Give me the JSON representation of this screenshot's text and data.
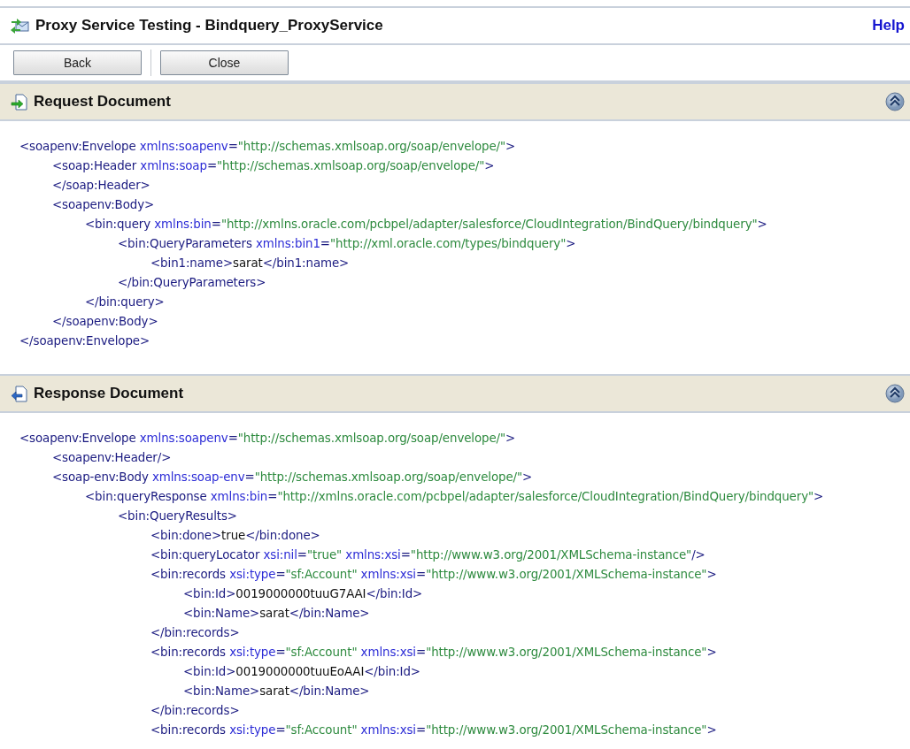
{
  "header": {
    "title": "Proxy Service Testing - Bindquery_ProxyService",
    "help": "Help"
  },
  "buttons": [
    {
      "label": "Back"
    },
    {
      "label": "Close"
    }
  ],
  "sections": [
    {
      "title": "Request Document",
      "kind": "request",
      "expanded": true,
      "lines": [
        {
          "tokens": [
            {
              "kind": "tag",
              "text": "<soapenv:Envelope "
            },
            {
              "kind": "attr",
              "text": "xmlns:soapenv"
            },
            {
              "kind": "tag",
              "text": "="
            },
            {
              "kind": "value",
              "text": "\"http://schemas.xmlsoap.org/soap/envelope/\""
            },
            {
              "kind": "tag",
              "text": ">"
            }
          ],
          "children": [
            {
              "tokens": [
                {
                  "kind": "tag",
                  "text": "<soap:Header "
                },
                {
                  "kind": "attr",
                  "text": "xmlns:soap"
                },
                {
                  "kind": "tag",
                  "text": "="
                },
                {
                  "kind": "value",
                  "text": "\"http://schemas.xmlsoap.org/soap/envelope/\""
                },
                {
                  "kind": "tag",
                  "text": ">"
                }
              ]
            },
            {
              "tokens": [
                {
                  "kind": "tag",
                  "text": "</soap:Header>"
                }
              ]
            },
            {
              "tokens": [
                {
                  "kind": "tag",
                  "text": "<soapenv:Body>"
                }
              ],
              "children": [
                {
                  "tokens": [
                    {
                      "kind": "tag",
                      "text": "<bin:query "
                    },
                    {
                      "kind": "attr",
                      "text": "xmlns:bin"
                    },
                    {
                      "kind": "tag",
                      "text": "="
                    },
                    {
                      "kind": "value",
                      "text": "\"http://xmlns.oracle.com/pcbpel/adapter/salesforce/CloudIntegration/BindQuery/bindquery\""
                    },
                    {
                      "kind": "tag",
                      "text": ">"
                    }
                  ],
                  "children": [
                    {
                      "tokens": [
                        {
                          "kind": "tag",
                          "text": "<bin:QueryParameters "
                        },
                        {
                          "kind": "attr",
                          "text": "xmlns:bin1"
                        },
                        {
                          "kind": "tag",
                          "text": "="
                        },
                        {
                          "kind": "value",
                          "text": "\"http://xml.oracle.com/types/bindquery\""
                        },
                        {
                          "kind": "tag",
                          "text": ">"
                        }
                      ],
                      "children": [
                        {
                          "tokens": [
                            {
                              "kind": "tag",
                              "text": "<bin1:name>"
                            },
                            {
                              "kind": "text",
                              "text": "sarat"
                            },
                            {
                              "kind": "tag",
                              "text": "</bin1:name>"
                            }
                          ]
                        }
                      ]
                    },
                    {
                      "tokens": [
                        {
                          "kind": "tag",
                          "text": "</bin:QueryParameters>"
                        }
                      ]
                    }
                  ]
                },
                {
                  "tokens": [
                    {
                      "kind": "tag",
                      "text": "</bin:query>"
                    }
                  ]
                }
              ]
            },
            {
              "tokens": [
                {
                  "kind": "tag",
                  "text": "</soapenv:Body>"
                }
              ]
            }
          ]
        },
        {
          "tokens": [
            {
              "kind": "tag",
              "text": "</soapenv:Envelope>"
            }
          ]
        }
      ]
    },
    {
      "title": "Response Document",
      "kind": "response",
      "expanded": true,
      "lines": [
        {
          "tokens": [
            {
              "kind": "tag",
              "text": "<soapenv:Envelope "
            },
            {
              "kind": "attr",
              "text": "xmlns:soapenv"
            },
            {
              "kind": "tag",
              "text": "="
            },
            {
              "kind": "value",
              "text": "\"http://schemas.xmlsoap.org/soap/envelope/\""
            },
            {
              "kind": "tag",
              "text": ">"
            }
          ],
          "children": [
            {
              "tokens": [
                {
                  "kind": "tag",
                  "text": "<soapenv:Header/>"
                }
              ]
            },
            {
              "tokens": [
                {
                  "kind": "tag",
                  "text": "<soap-env:Body "
                },
                {
                  "kind": "attr",
                  "text": "xmlns:soap-env"
                },
                {
                  "kind": "tag",
                  "text": "="
                },
                {
                  "kind": "value",
                  "text": "\"http://schemas.xmlsoap.org/soap/envelope/\""
                },
                {
                  "kind": "tag",
                  "text": ">"
                }
              ],
              "children": [
                {
                  "tokens": [
                    {
                      "kind": "tag",
                      "text": "<bin:queryResponse "
                    },
                    {
                      "kind": "attr",
                      "text": "xmlns:bin"
                    },
                    {
                      "kind": "tag",
                      "text": "="
                    },
                    {
                      "kind": "value",
                      "text": "\"http://xmlns.oracle.com/pcbpel/adapter/salesforce/CloudIntegration/BindQuery/bindquery\""
                    },
                    {
                      "kind": "tag",
                      "text": ">"
                    }
                  ],
                  "children": [
                    {
                      "tokens": [
                        {
                          "kind": "tag",
                          "text": "<bin:QueryResults>"
                        }
                      ],
                      "children": [
                        {
                          "tokens": [
                            {
                              "kind": "tag",
                              "text": "<bin:done>"
                            },
                            {
                              "kind": "text",
                              "text": "true"
                            },
                            {
                              "kind": "tag",
                              "text": "</bin:done>"
                            }
                          ]
                        },
                        {
                          "tokens": [
                            {
                              "kind": "tag",
                              "text": "<bin:queryLocator "
                            },
                            {
                              "kind": "attr",
                              "text": "xsi:nil"
                            },
                            {
                              "kind": "tag",
                              "text": "="
                            },
                            {
                              "kind": "value",
                              "text": "\"true\" "
                            },
                            {
                              "kind": "attr",
                              "text": "xmlns:xsi"
                            },
                            {
                              "kind": "tag",
                              "text": "="
                            },
                            {
                              "kind": "value",
                              "text": "\"http://www.w3.org/2001/XMLSchema-instance\""
                            },
                            {
                              "kind": "tag",
                              "text": "/>"
                            }
                          ]
                        },
                        {
                          "tokens": [
                            {
                              "kind": "tag",
                              "text": "<bin:records "
                            },
                            {
                              "kind": "attr",
                              "text": "xsi:type"
                            },
                            {
                              "kind": "tag",
                              "text": "="
                            },
                            {
                              "kind": "value",
                              "text": "\"sf:Account\" "
                            },
                            {
                              "kind": "attr",
                              "text": "xmlns:xsi"
                            },
                            {
                              "kind": "tag",
                              "text": "="
                            },
                            {
                              "kind": "value",
                              "text": "\"http://www.w3.org/2001/XMLSchema-instance\""
                            },
                            {
                              "kind": "tag",
                              "text": ">"
                            }
                          ],
                          "children": [
                            {
                              "tokens": [
                                {
                                  "kind": "tag",
                                  "text": "<bin:Id>"
                                },
                                {
                                  "kind": "text",
                                  "text": "0019000000tuuG7AAI"
                                },
                                {
                                  "kind": "tag",
                                  "text": "</bin:Id>"
                                }
                              ]
                            },
                            {
                              "tokens": [
                                {
                                  "kind": "tag",
                                  "text": "<bin:Name>"
                                },
                                {
                                  "kind": "text",
                                  "text": "sarat"
                                },
                                {
                                  "kind": "tag",
                                  "text": "</bin:Name>"
                                }
                              ]
                            }
                          ]
                        },
                        {
                          "tokens": [
                            {
                              "kind": "tag",
                              "text": "</bin:records>"
                            }
                          ]
                        },
                        {
                          "tokens": [
                            {
                              "kind": "tag",
                              "text": "<bin:records "
                            },
                            {
                              "kind": "attr",
                              "text": "xsi:type"
                            },
                            {
                              "kind": "tag",
                              "text": "="
                            },
                            {
                              "kind": "value",
                              "text": "\"sf:Account\" "
                            },
                            {
                              "kind": "attr",
                              "text": "xmlns:xsi"
                            },
                            {
                              "kind": "tag",
                              "text": "="
                            },
                            {
                              "kind": "value",
                              "text": "\"http://www.w3.org/2001/XMLSchema-instance\""
                            },
                            {
                              "kind": "tag",
                              "text": ">"
                            }
                          ],
                          "children": [
                            {
                              "tokens": [
                                {
                                  "kind": "tag",
                                  "text": "<bin:Id>"
                                },
                                {
                                  "kind": "text",
                                  "text": "0019000000tuuEoAAI"
                                },
                                {
                                  "kind": "tag",
                                  "text": "</bin:Id>"
                                }
                              ]
                            },
                            {
                              "tokens": [
                                {
                                  "kind": "tag",
                                  "text": "<bin:Name>"
                                },
                                {
                                  "kind": "text",
                                  "text": "sarat"
                                },
                                {
                                  "kind": "tag",
                                  "text": "</bin:Name>"
                                }
                              ]
                            }
                          ]
                        },
                        {
                          "tokens": [
                            {
                              "kind": "tag",
                              "text": "</bin:records>"
                            }
                          ]
                        },
                        {
                          "tokens": [
                            {
                              "kind": "tag",
                              "text": "<bin:records "
                            },
                            {
                              "kind": "attr",
                              "text": "xsi:type"
                            },
                            {
                              "kind": "tag",
                              "text": "="
                            },
                            {
                              "kind": "value",
                              "text": "\"sf:Account\" "
                            },
                            {
                              "kind": "attr",
                              "text": "xmlns:xsi"
                            },
                            {
                              "kind": "tag",
                              "text": "="
                            },
                            {
                              "kind": "value",
                              "text": "\"http://www.w3.org/2001/XMLSchema-instance\""
                            },
                            {
                              "kind": "tag",
                              "text": ">"
                            }
                          ]
                        }
                      ]
                    }
                  ]
                }
              ]
            }
          ]
        }
      ]
    }
  ]
}
